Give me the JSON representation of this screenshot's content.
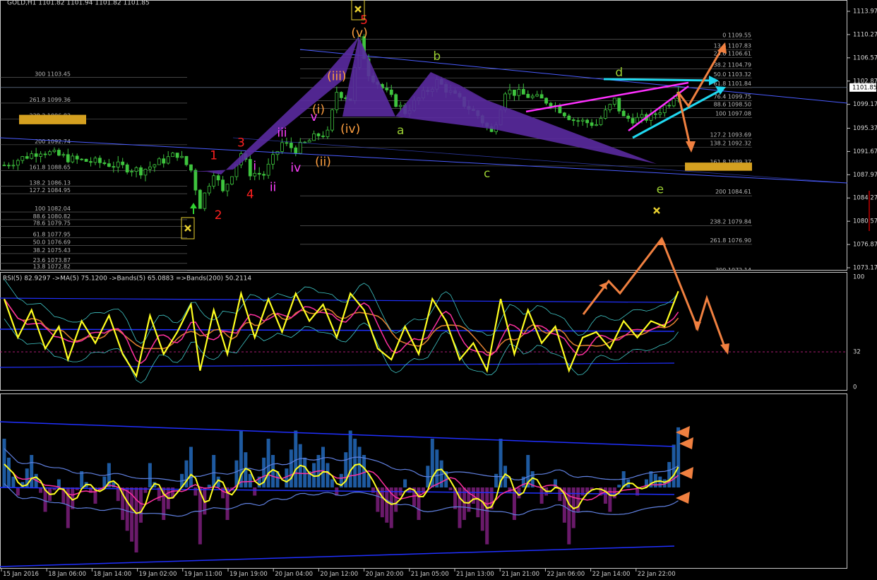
{
  "chart_data": {
    "type": "candlestick",
    "title": "GOLD,H1  1101.82 1101.94 1101.82 1101.85",
    "price_axis": {
      "ticks": [
        1113.97,
        1110.27,
        1106.57,
        1102.87,
        1099.17,
        1095.37,
        1091.67,
        1087.97,
        1084.27,
        1080.57,
        1076.87,
        1073.17
      ],
      "ylim": [
        1073.17,
        1115.7
      ],
      "current_price": "1101.85",
      "current_price_value": 1101.85
    },
    "time_axis": {
      "labels": [
        "15 Jan 2016",
        "18 Jan 06:00",
        "18 Jan 14:00",
        "19 Jan 02:00",
        "19 Jan 11:00",
        "19 Jan 19:00",
        "20 Jan 04:00",
        "20 Jan 12:00",
        "20 Jan 20:00",
        "21 Jan 05:00",
        "21 Jan 13:00",
        "21 Jan 21:00",
        "22 Jan 06:00",
        "22 Jan 14:00",
        "22 Jan 22:00"
      ]
    },
    "fib_right": [
      {
        "label": "0",
        "level": "1109.55",
        "price": 1109.55
      },
      {
        "label": "13.6",
        "level": "1107.83",
        "price": 1107.83
      },
      {
        "label": "23.6",
        "level": "1106.61",
        "price": 1106.61
      },
      {
        "label": "38.2",
        "level": "1104.79",
        "price": 1104.79
      },
      {
        "label": "50.0",
        "level": "1103.32",
        "price": 1103.32
      },
      {
        "label": "61.8",
        "level": "1101.84",
        "price": 1101.84
      },
      {
        "label": "76.4",
        "level": "1099.75",
        "price": 1099.75
      },
      {
        "label": "88.6",
        "level": "1098.50",
        "price": 1098.5
      },
      {
        "label": "100",
        "level": "1097.08",
        "price": 1097.08
      },
      {
        "label": "127.2",
        "level": "1093.69",
        "price": 1093.69
      },
      {
        "label": "138.2",
        "level": "1092.32",
        "price": 1092.32
      },
      {
        "label": "161.8",
        "level": "1089.37",
        "price": 1089.37
      },
      {
        "label": "200",
        "level": "1084.61",
        "price": 1084.61
      },
      {
        "label": "238.2",
        "level": "1079.84",
        "price": 1079.84
      },
      {
        "label": "261.8",
        "level": "1076.90",
        "price": 1076.9
      },
      {
        "label": "300",
        "level": "1072.14",
        "price": 1072.14
      }
    ],
    "fib_left": [
      {
        "label": "300",
        "level": "1103.45",
        "price": 1103.45
      },
      {
        "label": "261.8",
        "level": "1099.36",
        "price": 1099.36
      },
      {
        "label": "238.2",
        "level": "1096.83",
        "price": 1096.83
      },
      {
        "label": "200",
        "level": "1092.74",
        "price": 1092.74
      },
      {
        "label": "161.8",
        "level": "1088.65",
        "price": 1088.65
      },
      {
        "label": "138.2",
        "level": "1086.13",
        "price": 1086.13
      },
      {
        "label": "127.2",
        "level": "1084.95",
        "price": 1084.95
      },
      {
        "label": "100",
        "level": "1082.04",
        "price": 1082.04
      },
      {
        "label": "88.6",
        "level": "1080.82",
        "price": 1080.82
      },
      {
        "label": "78.6",
        "level": "1079.75",
        "price": 1079.75
      },
      {
        "label": "61.8",
        "level": "1077.95",
        "price": 1077.95
      },
      {
        "label": "50.0",
        "level": "1076.69",
        "price": 1076.69
      },
      {
        "label": "38.2",
        "level": "1075.43",
        "price": 1075.43
      },
      {
        "label": "23.6",
        "level": "1073.87",
        "price": 1073.87
      },
      {
        "label": "13.8",
        "level": "1072.82",
        "price": 1072.82
      }
    ],
    "wave_labels": [
      {
        "text": "1",
        "color": "#ff2020",
        "bar": 46,
        "price": 1091.0
      },
      {
        "text": "2",
        "color": "#ff2020",
        "bar": 47,
        "price": 1081.5
      },
      {
        "text": "3",
        "color": "#ff2020",
        "bar": 52,
        "price": 1093.0
      },
      {
        "text": "4",
        "color": "#ff2020",
        "bar": 54,
        "price": 1084.8
      },
      {
        "text": "5",
        "color": "#ff2020",
        "bar": 79,
        "price": 1112.5
      },
      {
        "text": "i",
        "color": "#ff40ff",
        "bar": 55,
        "price": 1089.3
      },
      {
        "text": "ii",
        "color": "#ff40ff",
        "bar": 59,
        "price": 1085.9
      },
      {
        "text": "iii",
        "color": "#ff40ff",
        "bar": 61,
        "price": 1094.6
      },
      {
        "text": "iv",
        "color": "#ff40ff",
        "bar": 64,
        "price": 1089.0
      },
      {
        "text": "v",
        "color": "#ff40ff",
        "bar": 68,
        "price": 1097.1
      },
      {
        "text": "(i)",
        "color": "#ffa040",
        "bar": 69,
        "price": 1098.3
      },
      {
        "text": "(ii)",
        "color": "#ffa040",
        "bar": 70,
        "price": 1090.0
      },
      {
        "text": "(iii)",
        "color": "#ffa040",
        "bar": 73,
        "price": 1103.6
      },
      {
        "text": "(iv)",
        "color": "#ffa040",
        "bar": 76,
        "price": 1095.2
      },
      {
        "text": "(v)",
        "color": "#ffa040",
        "bar": 78,
        "price": 1110.5
      },
      {
        "text": "a",
        "color": "#9acd32",
        "bar": 87,
        "price": 1095.0
      },
      {
        "text": "b",
        "color": "#9acd32",
        "bar": 95,
        "price": 1106.8
      },
      {
        "text": "c",
        "color": "#9acd32",
        "bar": 106,
        "price": 1088.1
      },
      {
        "text": "d",
        "color": "#9acd32",
        "bar": 135,
        "price": 1104.2
      },
      {
        "text": "e",
        "color": "#9acd32",
        "bar": 144,
        "price": 1085.6
      }
    ],
    "rsi": {
      "title": "RSI(5) 82.9297  ->MA(5) 75.1200  ->Bands(5) 65.0883  =>Bands(200) 50.2114",
      "scale_labels": [
        "100",
        "32",
        "0"
      ],
      "scale_values": [
        100,
        32,
        0
      ],
      "levels": [
        32
      ]
    }
  }
}
